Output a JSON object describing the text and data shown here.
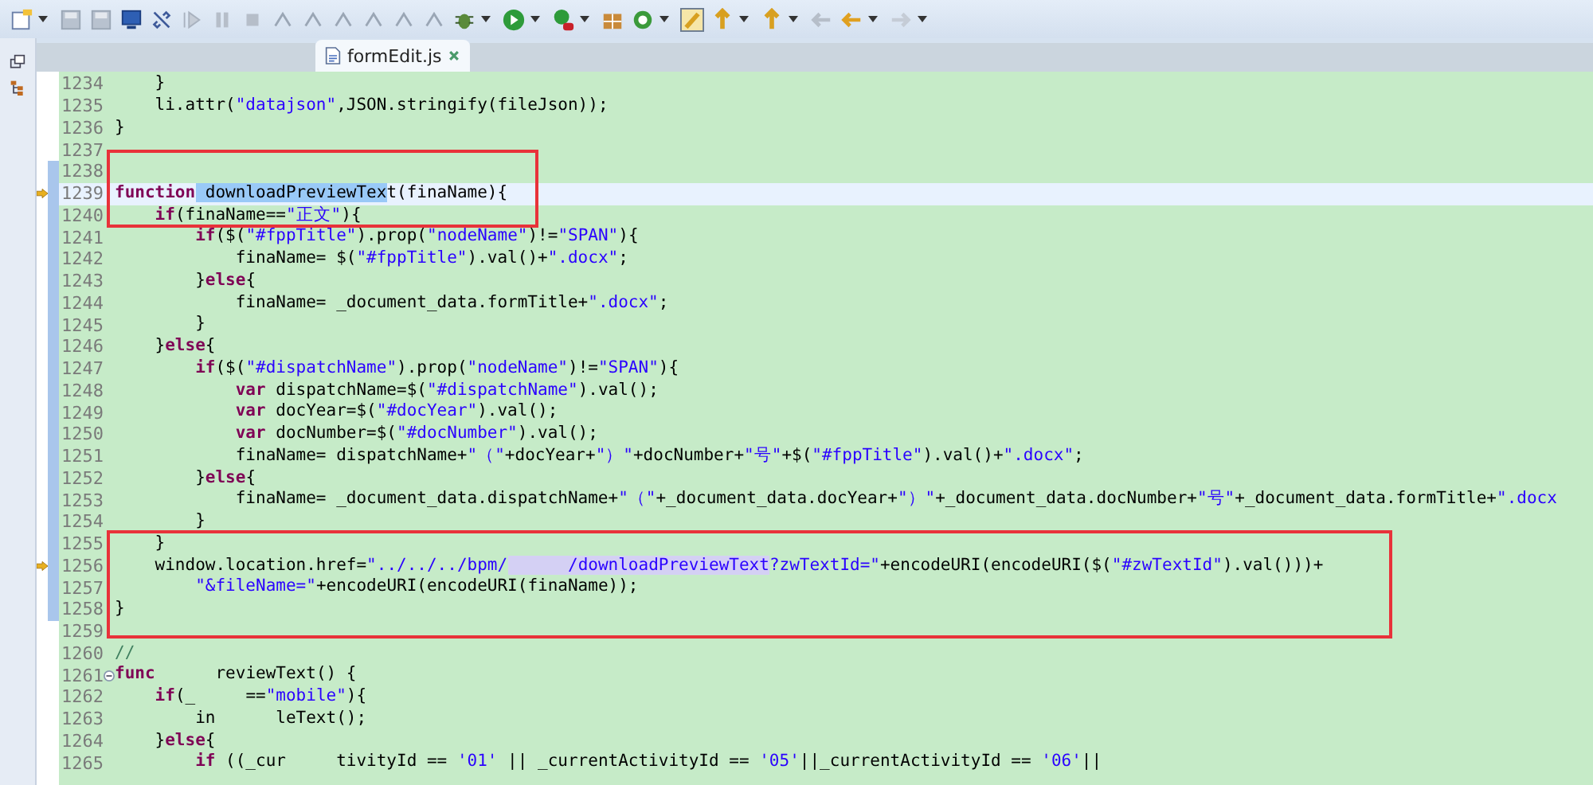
{
  "tabs": [
    {
      "label": "formEdit.js",
      "selected": true
    }
  ],
  "editor": {
    "lines": [
      {
        "number": "1234",
        "current": false,
        "marker": false,
        "changed": false,
        "foldable": false,
        "tokens": [
          {
            "kind": "plain",
            "text": "    }"
          }
        ]
      },
      {
        "number": "1235",
        "current": false,
        "marker": false,
        "changed": false,
        "foldable": false,
        "tokens": [
          {
            "kind": "plain",
            "text": "    li.attr("
          },
          {
            "kind": "str",
            "text": "\"datajson\""
          },
          {
            "kind": "plain",
            "text": ",JSON.stringify(fileJson));"
          }
        ]
      },
      {
        "number": "1236",
        "current": false,
        "marker": false,
        "changed": false,
        "foldable": false,
        "tokens": [
          {
            "kind": "plain",
            "text": "}"
          }
        ]
      },
      {
        "number": "1237",
        "current": false,
        "marker": false,
        "changed": false,
        "foldable": false
      },
      {
        "number": "1238",
        "current": false,
        "marker": false,
        "changed": true,
        "foldable": false
      },
      {
        "number": "1239",
        "current": true,
        "marker": true,
        "changed": true,
        "foldable": false,
        "tokens": [
          {
            "kind": "kw",
            "text": "function"
          },
          {
            "kind": "sel",
            "text": " downloadPreviewTex"
          },
          {
            "kind": "plain",
            "text": "t(finaName){"
          }
        ]
      },
      {
        "number": "1240",
        "current": false,
        "marker": false,
        "changed": true,
        "foldable": false,
        "tokens": [
          {
            "kind": "kw",
            "text": "    if"
          },
          {
            "kind": "plain",
            "text": "(finaName=="
          },
          {
            "kind": "str",
            "text": "\"正文\""
          },
          {
            "kind": "plain",
            "text": "){"
          }
        ]
      },
      {
        "number": "1241",
        "current": false,
        "marker": false,
        "changed": true,
        "foldable": false,
        "tokens": [
          {
            "kind": "kw",
            "text": "        if"
          },
          {
            "kind": "plain",
            "text": "($("
          },
          {
            "kind": "str",
            "text": "\"#fppTitle\""
          },
          {
            "kind": "plain",
            "text": ").prop("
          },
          {
            "kind": "str",
            "text": "\"nodeName\""
          },
          {
            "kind": "plain",
            "text": ")!="
          },
          {
            "kind": "str",
            "text": "\"SPAN\""
          },
          {
            "kind": "plain",
            "text": "){"
          }
        ]
      },
      {
        "number": "1242",
        "current": false,
        "marker": false,
        "changed": true,
        "foldable": false,
        "tokens": [
          {
            "kind": "plain",
            "text": "            finaName= $("
          },
          {
            "kind": "str",
            "text": "\"#fppTitle\""
          },
          {
            "kind": "plain",
            "text": ").val()+"
          },
          {
            "kind": "str",
            "text": "\".docx\""
          },
          {
            "kind": "plain",
            "text": ";"
          }
        ]
      },
      {
        "number": "1243",
        "current": false,
        "marker": false,
        "changed": true,
        "foldable": false,
        "tokens": [
          {
            "kind": "plain",
            "text": "        }"
          },
          {
            "kind": "kw",
            "text": "else"
          },
          {
            "kind": "plain",
            "text": "{"
          }
        ]
      },
      {
        "number": "1244",
        "current": false,
        "marker": false,
        "changed": true,
        "foldable": false,
        "tokens": [
          {
            "kind": "plain",
            "text": "            finaName= _document_data.formTitle+"
          },
          {
            "kind": "str",
            "text": "\".docx\""
          },
          {
            "kind": "plain",
            "text": ";"
          }
        ]
      },
      {
        "number": "1245",
        "current": false,
        "marker": false,
        "changed": true,
        "foldable": false,
        "tokens": [
          {
            "kind": "plain",
            "text": "        }"
          }
        ]
      },
      {
        "number": "1246",
        "current": false,
        "marker": false,
        "changed": true,
        "foldable": false,
        "tokens": [
          {
            "kind": "plain",
            "text": "    }"
          },
          {
            "kind": "kw",
            "text": "else"
          },
          {
            "kind": "plain",
            "text": "{"
          }
        ]
      },
      {
        "number": "1247",
        "current": false,
        "marker": false,
        "changed": true,
        "foldable": false,
        "tokens": [
          {
            "kind": "kw",
            "text": "        if"
          },
          {
            "kind": "plain",
            "text": "($("
          },
          {
            "kind": "str",
            "text": "\"#dispatchName\""
          },
          {
            "kind": "plain",
            "text": ").prop("
          },
          {
            "kind": "str",
            "text": "\"nodeName\""
          },
          {
            "kind": "plain",
            "text": ")!="
          },
          {
            "kind": "str",
            "text": "\"SPAN\""
          },
          {
            "kind": "plain",
            "text": "){"
          }
        ]
      },
      {
        "number": "1248",
        "current": false,
        "marker": false,
        "changed": true,
        "foldable": false,
        "tokens": [
          {
            "kind": "kw",
            "text": "            var"
          },
          {
            "kind": "plain",
            "text": " dispatchName=$("
          },
          {
            "kind": "str",
            "text": "\"#dispatchName\""
          },
          {
            "kind": "plain",
            "text": ").val();"
          }
        ]
      },
      {
        "number": "1249",
        "current": false,
        "marker": false,
        "changed": true,
        "foldable": false,
        "tokens": [
          {
            "kind": "kw",
            "text": "            var"
          },
          {
            "kind": "plain",
            "text": " docYear=$("
          },
          {
            "kind": "str",
            "text": "\"#docYear\""
          },
          {
            "kind": "plain",
            "text": ").val();"
          }
        ]
      },
      {
        "number": "1250",
        "current": false,
        "marker": false,
        "changed": true,
        "foldable": false,
        "tokens": [
          {
            "kind": "kw",
            "text": "            var"
          },
          {
            "kind": "plain",
            "text": " docNumber=$("
          },
          {
            "kind": "str",
            "text": "\"#docNumber\""
          },
          {
            "kind": "plain",
            "text": ").val();"
          }
        ]
      },
      {
        "number": "1251",
        "current": false,
        "marker": false,
        "changed": true,
        "foldable": false,
        "tokens": [
          {
            "kind": "plain",
            "text": "            finaName= dispatchName+"
          },
          {
            "kind": "str",
            "text": "\"（\""
          },
          {
            "kind": "plain",
            "text": "+docYear+"
          },
          {
            "kind": "str",
            "text": "\"）\""
          },
          {
            "kind": "plain",
            "text": "+docNumber+"
          },
          {
            "kind": "str",
            "text": "\"号\""
          },
          {
            "kind": "plain",
            "text": "+$("
          },
          {
            "kind": "str",
            "text": "\"#fppTitle\""
          },
          {
            "kind": "plain",
            "text": ").val()+"
          },
          {
            "kind": "str",
            "text": "\".docx\""
          },
          {
            "kind": "plain",
            "text": ";"
          }
        ]
      },
      {
        "number": "1252",
        "current": false,
        "marker": false,
        "changed": true,
        "foldable": false,
        "tokens": [
          {
            "kind": "plain",
            "text": "        }"
          },
          {
            "kind": "kw",
            "text": "else"
          },
          {
            "kind": "plain",
            "text": "{"
          }
        ]
      },
      {
        "number": "1253",
        "current": false,
        "marker": false,
        "changed": true,
        "foldable": false,
        "tokens": [
          {
            "kind": "plain",
            "text": "            finaName= _document_data.dispatchName+"
          },
          {
            "kind": "str",
            "text": "\"（\""
          },
          {
            "kind": "plain",
            "text": "+_document_data.docYear+"
          },
          {
            "kind": "str",
            "text": "\"）\""
          },
          {
            "kind": "plain",
            "text": "+_document_data.docNumber+"
          },
          {
            "kind": "str",
            "text": "\"号\""
          },
          {
            "kind": "plain",
            "text": "+_document_data.formTitle+"
          },
          {
            "kind": "str",
            "text": "\".docx"
          }
        ]
      },
      {
        "number": "1254",
        "current": false,
        "marker": false,
        "changed": true,
        "foldable": false,
        "tokens": [
          {
            "kind": "plain",
            "text": "        }"
          }
        ]
      },
      {
        "number": "1255",
        "current": false,
        "marker": false,
        "changed": true,
        "foldable": false,
        "tokens": [
          {
            "kind": "plain",
            "text": "    }"
          }
        ]
      },
      {
        "number": "1256",
        "current": false,
        "marker": true,
        "changed": true,
        "foldable": false,
        "tokens": [
          {
            "kind": "plain",
            "text": "    window.location.href="
          },
          {
            "kind": "str",
            "text": "\"../../../bpm/"
          },
          {
            "kind": "occ",
            "text": "      /downloadPreviewText"
          },
          {
            "kind": "str",
            "text": "?zwTextId=\""
          },
          {
            "kind": "plain",
            "text": "+encodeURI(encodeURI($("
          },
          {
            "kind": "str",
            "text": "\"#zwTextId\""
          },
          {
            "kind": "plain",
            "text": ").val()))+"
          }
        ]
      },
      {
        "number": "1257",
        "current": false,
        "marker": false,
        "changed": true,
        "foldable": false,
        "tokens": [
          {
            "kind": "str",
            "text": "        \"&fileName=\""
          },
          {
            "kind": "plain",
            "text": "+encodeURI(encodeURI(finaName));"
          }
        ]
      },
      {
        "number": "1258",
        "current": false,
        "marker": false,
        "changed": true,
        "foldable": false,
        "tokens": [
          {
            "kind": "plain",
            "text": "}"
          }
        ]
      },
      {
        "number": "1259",
        "current": false,
        "marker": false,
        "changed": false,
        "foldable": false
      },
      {
        "number": "1260",
        "current": false,
        "marker": false,
        "changed": false,
        "foldable": false,
        "tokens": [
          {
            "kind": "com",
            "text": "//"
          }
        ]
      },
      {
        "number": "1261",
        "current": false,
        "marker": false,
        "changed": false,
        "foldable": true,
        "tokens": [
          {
            "kind": "kw",
            "text": "func"
          },
          {
            "kind": "plain",
            "text": "      reviewText() {"
          }
        ]
      },
      {
        "number": "1262",
        "current": false,
        "marker": false,
        "changed": false,
        "foldable": false,
        "tokens": [
          {
            "kind": "kw",
            "text": "    if"
          },
          {
            "kind": "plain",
            "text": "(_     =="
          },
          {
            "kind": "str",
            "text": "\"mobile\""
          },
          {
            "kind": "plain",
            "text": "){"
          }
        ]
      },
      {
        "number": "1263",
        "current": false,
        "marker": false,
        "changed": false,
        "foldable": false,
        "tokens": [
          {
            "kind": "plain",
            "text": "        in      leText();"
          }
        ]
      },
      {
        "number": "1264",
        "current": false,
        "marker": false,
        "changed": false,
        "foldable": false,
        "tokens": [
          {
            "kind": "plain",
            "text": "    }"
          },
          {
            "kind": "kw",
            "text": "else"
          },
          {
            "kind": "plain",
            "text": "{"
          }
        ]
      },
      {
        "number": "1265",
        "current": false,
        "marker": false,
        "changed": false,
        "foldable": false,
        "tokens": [
          {
            "kind": "kw",
            "text": "        if"
          },
          {
            "kind": "plain",
            "text": " ((_cur     tivityId == "
          },
          {
            "kind": "str",
            "text": "'01'"
          },
          {
            "kind": "plain",
            "text": " || _currentActivityId == "
          },
          {
            "kind": "str",
            "text": "'05'"
          },
          {
            "kind": "plain",
            "text": "||_currentActivityId == "
          },
          {
            "kind": "str",
            "text": "'06'"
          },
          {
            "kind": "plain",
            "text": "||"
          }
        ]
      }
    ]
  }
}
